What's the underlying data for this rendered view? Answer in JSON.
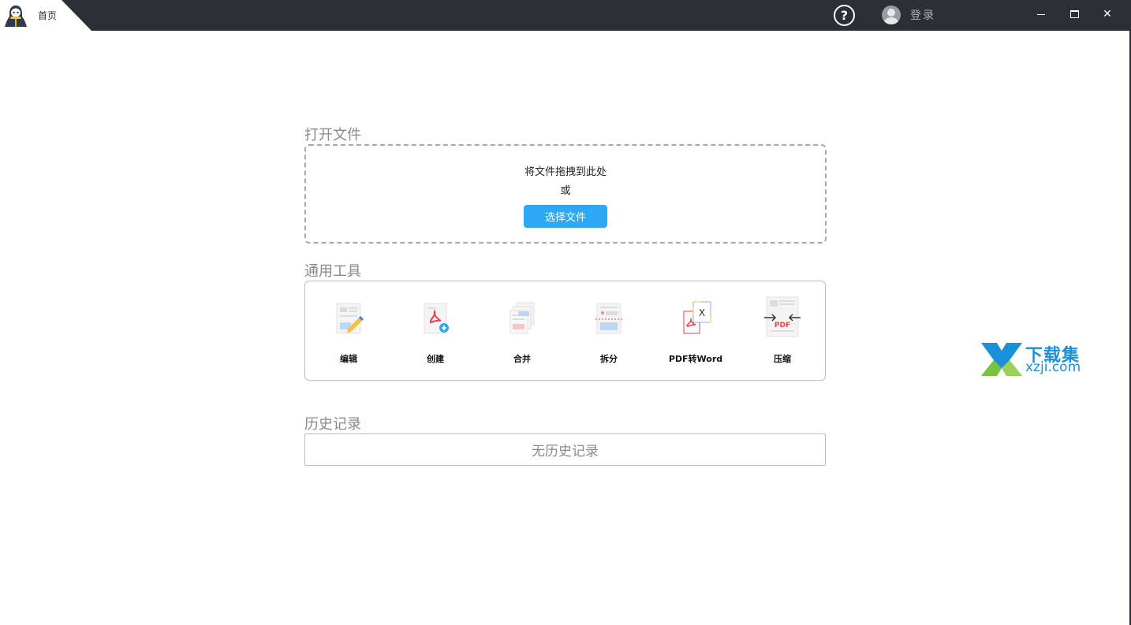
{
  "titlebar": {
    "tab_label": "首页",
    "help_label": "?",
    "login_label": "登录",
    "close_label": "✕"
  },
  "open_file": {
    "title": "打开文件",
    "drop_hint": "将文件拖拽到此处",
    "or_text": "或",
    "choose_button": "选择文件"
  },
  "tools": {
    "title": "通用工具",
    "items": [
      {
        "label": "编辑",
        "icon": "edit-icon"
      },
      {
        "label": "创建",
        "icon": "create-pdf-icon"
      },
      {
        "label": "合并",
        "icon": "merge-icon"
      },
      {
        "label": "拆分",
        "icon": "split-icon"
      },
      {
        "label": "PDF转Word",
        "icon": "pdf-to-word-icon"
      },
      {
        "label": "压缩",
        "icon": "compress-icon"
      }
    ]
  },
  "history": {
    "title": "历史记录",
    "empty_text": "无历史记录"
  },
  "watermark": {
    "title": "下载集",
    "subtitle": "xzji.com"
  },
  "colors": {
    "titlebar_bg": "#2d2f36",
    "accent": "#2ea7f5",
    "pdf_red": "#e8434d"
  }
}
